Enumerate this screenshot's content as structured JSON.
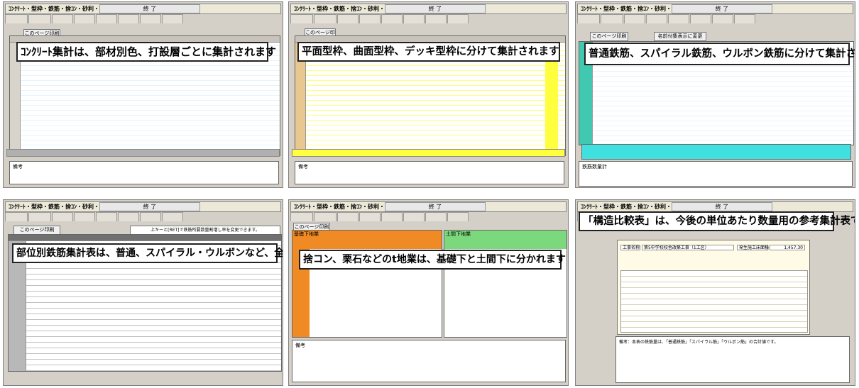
{
  "app": {
    "window_title": "ｺﾝｸﾘｰﾄ・型枠・鉄筋・捨ｺﾝ・砂利・印刷",
    "exit_label": "終 了"
  },
  "panels": {
    "concrete": {
      "print_label": "このページ印刷",
      "caption": "ｺﾝｸﾘｰﾄ集計は、部材別色、打設層ごとに集計されます",
      "memo_label": "備考"
    },
    "formwork": {
      "print_label": "このページ印刷",
      "caption": "平面型枠、曲面型枠、デッキ型枠に分けて集計されます",
      "memo_label": "備考"
    },
    "rebar": {
      "print_label": "このページ印刷",
      "rename_label": "名前付集表示に変更",
      "caption": "普通鉄筋、スパイラル鉄筋、ウルボン鉄筋に分けて集計されます",
      "total_label": "鉄筋数量計"
    },
    "member": {
      "print_label": "このページ印刷",
      "hint": "上キーと[RET]で鉄筋所要数量割増し率を変更できます。",
      "caption": "部位別鉄筋集計表は、普通、スパイラル・ウルボンなど、全ての鉄筋の数量です"
    },
    "subgrade": {
      "print_label": "このページ印刷",
      "left_header": "基礎下地業",
      "right_header": "土間下地業",
      "caption": "捨コン、栗石などのt地業は、基礎下と土間下に分かれます",
      "memo_label": "備考"
    },
    "compare": {
      "caption": "「構造比較表」は、今後の単位あたり数量用の参考集計表です",
      "project_label": "工事名称",
      "project_value": "第5中学校校舎改築工事（1工区）",
      "area_label": "発生施工床面積",
      "area_value": "1,457.30",
      "note": "備考：本表の鉄筋量は、「普通鉄筋」「スパイラル筋」「ウルボン筋」の合計値です。"
    }
  },
  "colors": {
    "yellow": "#ffff40",
    "cyan": "#40e0e0",
    "orange": "#f08a24",
    "green": "#7cd87c"
  }
}
